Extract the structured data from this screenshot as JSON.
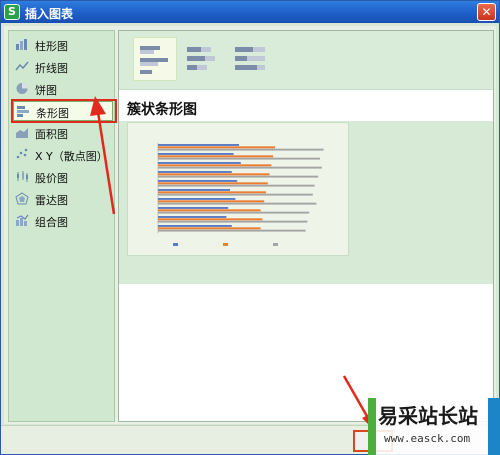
{
  "window": {
    "title": "插入图表",
    "app_icon": "S"
  },
  "sidebar": {
    "items": [
      {
        "label": "柱形图",
        "icon": "column-chart-icon"
      },
      {
        "label": "折线图",
        "icon": "line-chart-icon"
      },
      {
        "label": "饼图",
        "icon": "pie-chart-icon"
      },
      {
        "label": "条形图",
        "icon": "bar-chart-icon",
        "selected": true
      },
      {
        "label": "面积图",
        "icon": "area-chart-icon"
      },
      {
        "label": "X Y（散点图）",
        "icon": "scatter-chart-icon"
      },
      {
        "label": "股价图",
        "icon": "stock-chart-icon"
      },
      {
        "label": "雷达图",
        "icon": "radar-chart-icon"
      },
      {
        "label": "组合图",
        "icon": "combo-chart-icon"
      }
    ]
  },
  "content": {
    "subtype_title": "簇状条形图",
    "subtypes": [
      "clustered-bar-icon",
      "stacked-bar-icon",
      "percent-stacked-bar-icon"
    ]
  },
  "chart_data": {
    "type": "bar",
    "title": "",
    "categories": [
      "",
      "",
      "",
      "",
      "",
      "",
      "",
      "",
      "",
      ""
    ],
    "series": [
      {
        "values": [
          45,
          42,
          46,
          41,
          44,
          40,
          43,
          39,
          38,
          41
        ],
        "color": "#5a7cc4"
      },
      {
        "values": [
          65,
          64,
          63,
          62,
          61,
          60,
          59,
          57,
          58,
          57
        ],
        "color": "#ed7d31"
      },
      {
        "values": [
          92,
          90,
          91,
          89,
          87,
          86,
          88,
          84,
          83,
          82
        ],
        "color": "#a5a5a5"
      }
    ],
    "xlim": [
      0,
      100
    ],
    "grid": false,
    "legend": "bottom"
  },
  "watermark": {
    "title": "易采站长站",
    "url": "www.easck.com"
  },
  "colors": {
    "title_bar": "#1e5fc7",
    "highlight": "#e02a1e",
    "panel": "#cfe8cf"
  }
}
